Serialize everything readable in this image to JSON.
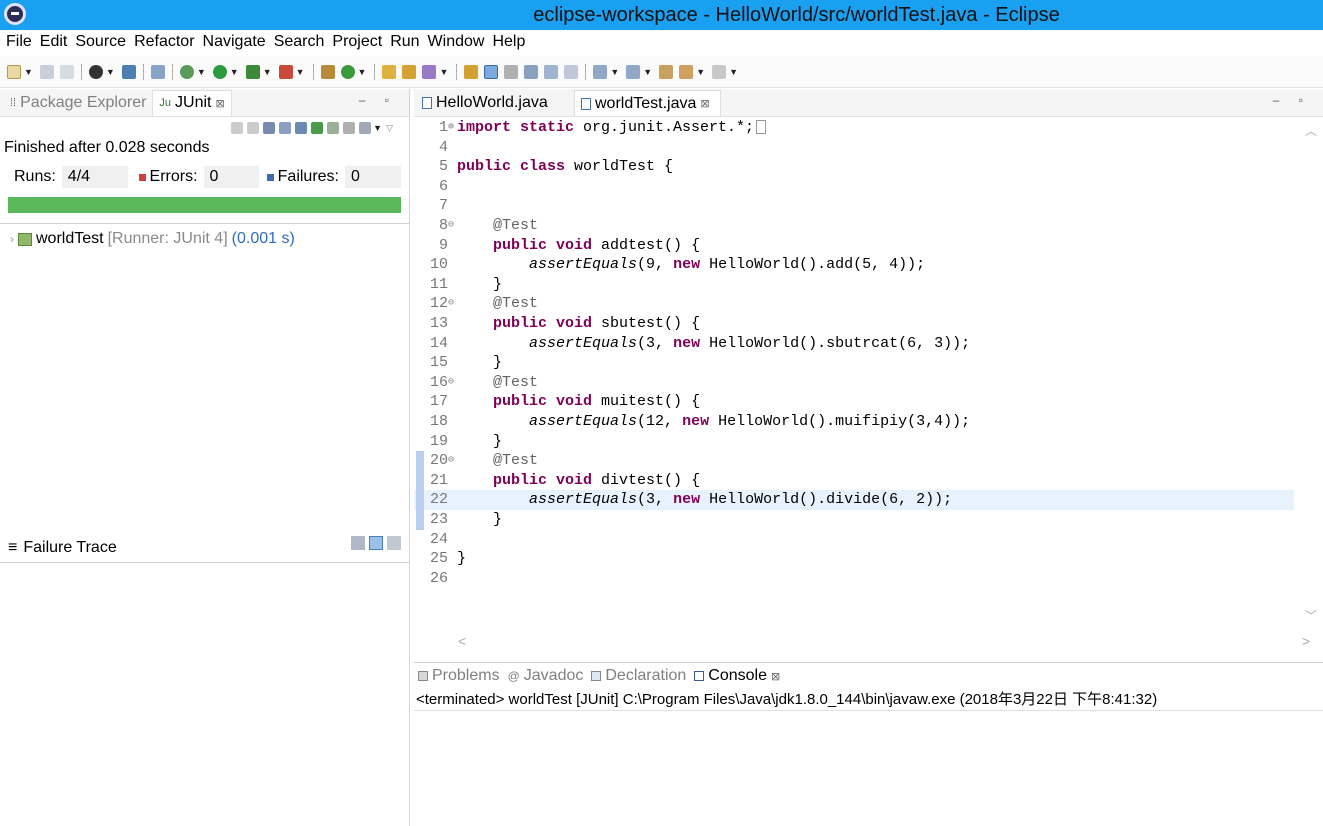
{
  "window": {
    "title": "eclipse-workspace - HelloWorld/src/worldTest.java - Eclipse"
  },
  "menu": [
    "File",
    "Edit",
    "Source",
    "Refactor",
    "Navigate",
    "Search",
    "Project",
    "Run",
    "Window",
    "Help"
  ],
  "left_panel": {
    "tabs": [
      {
        "label": "Package Explorer",
        "active": false
      },
      {
        "label": "JUnit",
        "active": true
      }
    ],
    "finished_text": "Finished after 0.028 seconds",
    "runs_label": "Runs:",
    "runs_value": "4/4",
    "errors_label": "Errors:",
    "errors_value": "0",
    "failures_label": "Failures:",
    "failures_value": "0",
    "progress_fraction": 1.0,
    "progress_color": "#5bb85b",
    "test_tree": {
      "name": "worldTest",
      "runner": "[Runner: JUnit 4]",
      "elapsed": "(0.001 s)"
    },
    "failure_trace_label": "Failure Trace"
  },
  "editor": {
    "tabs": [
      {
        "label": "HelloWorld.java",
        "active": false
      },
      {
        "label": "worldTest.java",
        "active": true
      }
    ],
    "current_line": 22,
    "lines": [
      {
        "n": "1",
        "fold": "+",
        "tokens": [
          [
            "kw",
            "import static"
          ],
          [
            "n",
            " org.junit.Assert.*;"
          ],
          [
            "box",
            ""
          ]
        ]
      },
      {
        "n": "4",
        "fold": "",
        "tokens": []
      },
      {
        "n": "5",
        "fold": "",
        "tokens": [
          [
            "kw",
            "public class"
          ],
          [
            "n",
            " worldTest {"
          ]
        ]
      },
      {
        "n": "6",
        "fold": "",
        "tokens": []
      },
      {
        "n": "7",
        "fold": "",
        "tokens": []
      },
      {
        "n": "8",
        "fold": "-",
        "tokens": [
          [
            "n",
            "    "
          ],
          [
            "ann",
            "@Test"
          ]
        ]
      },
      {
        "n": "9",
        "fold": "",
        "tokens": [
          [
            "n",
            "    "
          ],
          [
            "kw",
            "public void"
          ],
          [
            "n",
            " addtest() {"
          ]
        ]
      },
      {
        "n": "10",
        "fold": "",
        "tokens": [
          [
            "n",
            "        "
          ],
          [
            "itl",
            "assertEquals"
          ],
          [
            "n",
            "(9, "
          ],
          [
            "kw",
            "new"
          ],
          [
            "n",
            " HelloWorld().add(5, 4));"
          ]
        ]
      },
      {
        "n": "11",
        "fold": "",
        "tokens": [
          [
            "n",
            "    }"
          ]
        ]
      },
      {
        "n": "12",
        "fold": "-",
        "tokens": [
          [
            "n",
            "    "
          ],
          [
            "ann",
            "@Test"
          ]
        ]
      },
      {
        "n": "13",
        "fold": "",
        "tokens": [
          [
            "n",
            "    "
          ],
          [
            "kw",
            "public void"
          ],
          [
            "n",
            " sbutest() {"
          ]
        ]
      },
      {
        "n": "14",
        "fold": "",
        "tokens": [
          [
            "n",
            "        "
          ],
          [
            "itl",
            "assertEquals"
          ],
          [
            "n",
            "(3, "
          ],
          [
            "kw",
            "new"
          ],
          [
            "n",
            " HelloWorld().sbutrcat(6, 3));"
          ]
        ]
      },
      {
        "n": "15",
        "fold": "",
        "tokens": [
          [
            "n",
            "    }"
          ]
        ]
      },
      {
        "n": "16",
        "fold": "-",
        "tokens": [
          [
            "n",
            "    "
          ],
          [
            "ann",
            "@Test"
          ]
        ]
      },
      {
        "n": "17",
        "fold": "",
        "tokens": [
          [
            "n",
            "    "
          ],
          [
            "kw",
            "public void"
          ],
          [
            "n",
            " muitest() {"
          ]
        ]
      },
      {
        "n": "18",
        "fold": "",
        "tokens": [
          [
            "n",
            "        "
          ],
          [
            "itl",
            "assertEquals"
          ],
          [
            "n",
            "(12, "
          ],
          [
            "kw",
            "new"
          ],
          [
            "n",
            " HelloWorld().muifipiy(3,4));"
          ]
        ]
      },
      {
        "n": "19",
        "fold": "",
        "tokens": [
          [
            "n",
            "    }"
          ]
        ]
      },
      {
        "n": "20",
        "fold": "-",
        "tokens": [
          [
            "n",
            "    "
          ],
          [
            "ann",
            "@Test"
          ]
        ]
      },
      {
        "n": "21",
        "fold": "",
        "tokens": [
          [
            "n",
            "    "
          ],
          [
            "kw",
            "public void"
          ],
          [
            "n",
            " divtest() {"
          ]
        ]
      },
      {
        "n": "22",
        "fold": "",
        "tokens": [
          [
            "n",
            "        "
          ],
          [
            "itl",
            "assertEquals"
          ],
          [
            "n",
            "(3, "
          ],
          [
            "kw",
            "new"
          ],
          [
            "n",
            " HelloWorld().divide(6, 2));"
          ]
        ]
      },
      {
        "n": "23",
        "fold": "",
        "tokens": [
          [
            "n",
            "    }"
          ]
        ]
      },
      {
        "n": "24",
        "fold": "",
        "tokens": []
      },
      {
        "n": "25",
        "fold": "",
        "tokens": [
          [
            "n",
            "}"
          ]
        ]
      },
      {
        "n": "26",
        "fold": "",
        "tokens": []
      }
    ],
    "colors": {
      "keyword": "#7f0055",
      "annotation": "#646464",
      "current_line_bg": "#e8f2fe"
    }
  },
  "console": {
    "tabs": [
      {
        "label": "Problems",
        "active": false
      },
      {
        "label": "Javadoc",
        "active": false
      },
      {
        "label": "Declaration",
        "active": false
      },
      {
        "label": "Console",
        "active": true
      }
    ],
    "terminated_text": "<terminated> worldTest [JUnit] C:\\Program Files\\Java\\jdk1.8.0_144\\bin\\javaw.exe (2018年3月22日 下午8:41:32)"
  }
}
